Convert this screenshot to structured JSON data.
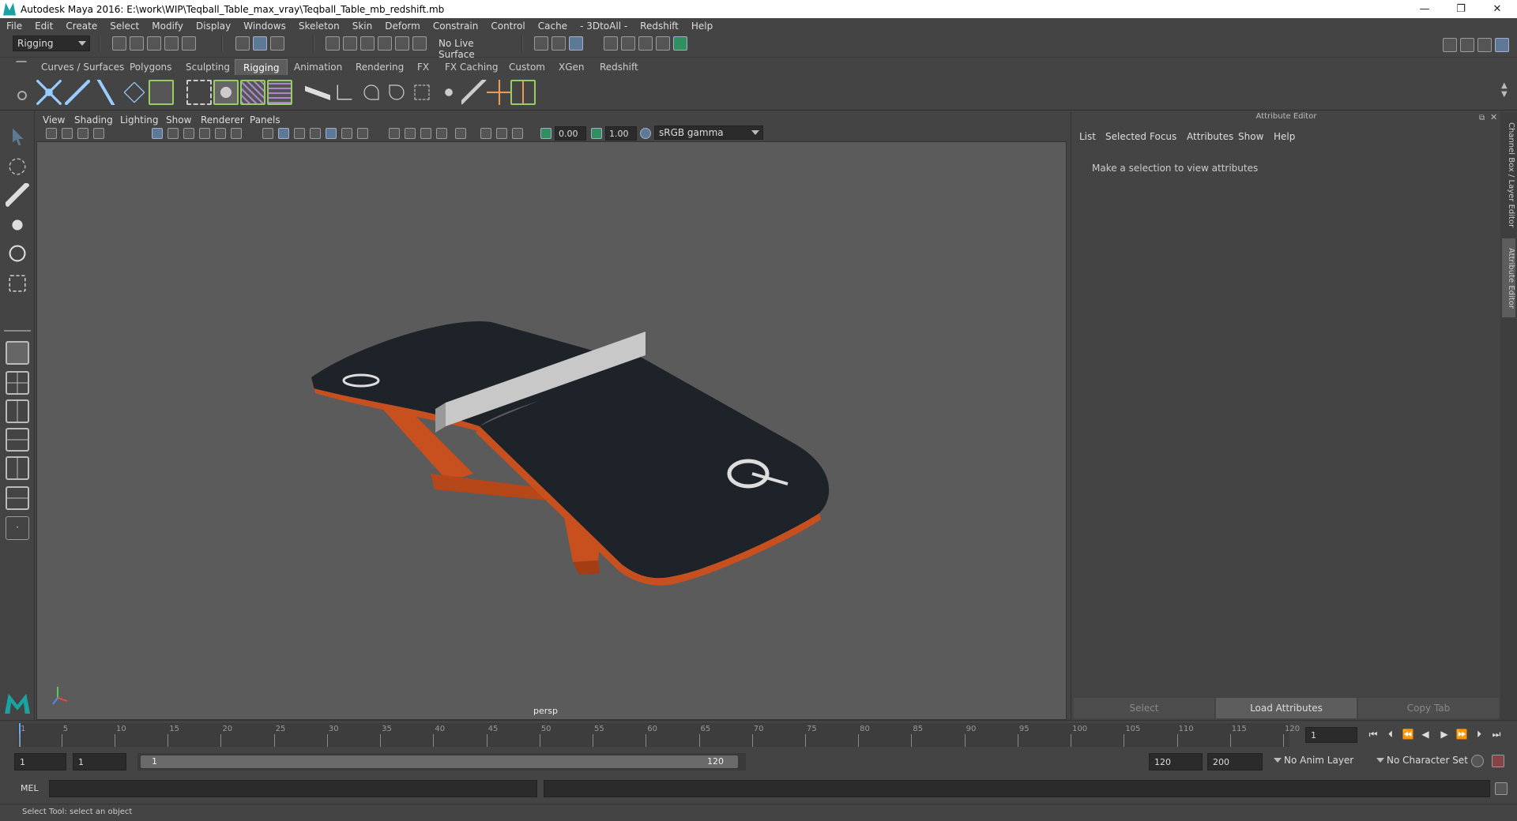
{
  "window": {
    "title": "Autodesk Maya 2016: E:\\work\\WIP\\Teqball_Table_max_vray\\Teqball_Table_mb_redshift.mb"
  },
  "menus": [
    "File",
    "Edit",
    "Create",
    "Select",
    "Modify",
    "Display",
    "Windows",
    "Skeleton",
    "Skin",
    "Deform",
    "Constrain",
    "Control",
    "Cache",
    "- 3DtoAll -",
    "Redshift",
    "Help"
  ],
  "status_line": {
    "mode": "Rigging",
    "live_surface": "No Live Surface"
  },
  "shelf_tabs": [
    "Curves / Surfaces",
    "Polygons",
    "Sculpting",
    "Rigging",
    "Animation",
    "Rendering",
    "FX",
    "FX Caching",
    "Custom",
    "XGen",
    "Redshift"
  ],
  "active_shelf": "Rigging",
  "viewport": {
    "menus": [
      "View",
      "Shading",
      "Lighting",
      "Show",
      "Renderer",
      "Panels"
    ],
    "exposure": "0.00",
    "gamma": "1.00",
    "color_space": "sRGB gamma",
    "camera": "persp"
  },
  "attribute_editor": {
    "title": "Attribute Editor",
    "menus": [
      "List",
      "Selected",
      "Focus",
      "Attributes",
      "Show",
      "Help"
    ],
    "message": "Make a selection to view attributes",
    "buttons": {
      "select": "Select",
      "load": "Load Attributes",
      "copy": "Copy Tab"
    }
  },
  "side_tabs": {
    "channel_box": "Channel Box / Layer Editor",
    "attribute_editor": "Attribute Editor"
  },
  "time_slider": {
    "ticks": [
      "1",
      "5",
      "10",
      "15",
      "20",
      "25",
      "30",
      "35",
      "40",
      "45",
      "50",
      "55",
      "60",
      "65",
      "70",
      "75",
      "80",
      "85",
      "90",
      "95",
      "100",
      "105",
      "110",
      "115",
      "120"
    ],
    "current_frame": "1"
  },
  "range": {
    "start": "1",
    "playback_start": "1",
    "slider_start": "1",
    "slider_end": "120",
    "playback_end": "120",
    "end": "200",
    "anim_layer": "No Anim Layer",
    "character_set": "No Character Set"
  },
  "command_line": {
    "label": "MEL"
  },
  "help_line": "Select Tool: select an object",
  "colors": {
    "accent": "#5c7a96",
    "table_top": "#1e2329",
    "table_frame": "#c8501e",
    "net": "#c8c8c8",
    "viewport_bg": "#5b5b5b"
  }
}
